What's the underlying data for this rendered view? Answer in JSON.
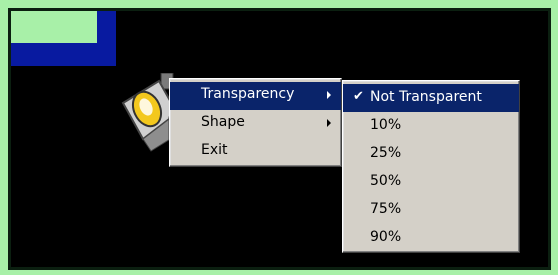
{
  "context_menu": {
    "items": [
      {
        "label": "Transparency",
        "has_submenu": true,
        "highlighted": true
      },
      {
        "label": "Shape",
        "has_submenu": true,
        "highlighted": false
      },
      {
        "label": "Exit",
        "has_submenu": false,
        "highlighted": false
      }
    ]
  },
  "transparency_submenu": {
    "items": [
      {
        "label": "Not Transparent",
        "checked": true,
        "highlighted": true
      },
      {
        "label": "10%"
      },
      {
        "label": "25%"
      },
      {
        "label": "50%"
      },
      {
        "label": "75%"
      },
      {
        "label": "90%"
      }
    ]
  },
  "colors": {
    "background_green": "#a8f0a8",
    "desktop_black": "#000000",
    "block_blue": "#081aa0",
    "menu_face": "#d4d0c8",
    "highlight": "#0a246a"
  },
  "icons": {
    "app_icon": "spotlight-lamp-icon",
    "check": "checkmark-icon",
    "submenu_arrow": "triangle-right-icon"
  }
}
